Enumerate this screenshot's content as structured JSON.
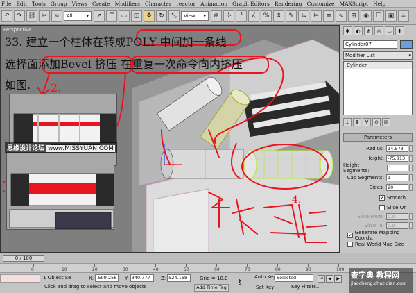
{
  "menu": [
    "File",
    "Edit",
    "Tools",
    "Group",
    "Views",
    "Create",
    "Modifiers",
    "Character",
    "reactor",
    "Animation",
    "Graph Editors",
    "Rendering",
    "Customize",
    "MAXScript",
    "Help"
  ],
  "toolbar": {
    "selection_filter": "All",
    "ref_coord": "View"
  },
  "viewport": {
    "label": "Perspective",
    "tutorial_line1": "33. 建立一个柱体在转成POLY 中间加一条线",
    "tutorial_line2": "选择面添加Bevel 挤压 在重复一次命令向内挤压",
    "tutorial_line3": "如图.",
    "watermark_text": "思缘设计论坛",
    "watermark_url": "www.MISSYUAN.COM",
    "annot_2": "2.",
    "annot_3": "3.",
    "annot_4": "4.",
    "annot_handwriting": "放柱这里"
  },
  "command_panel": {
    "object_name": "Cylinder07",
    "modifier_list": "Modifier List",
    "stack_item": "Cylinder",
    "rollout": "Parameters",
    "params": {
      "radius_label": "Radius:",
      "radius": "14.573",
      "height_label": "Height:",
      "height": "-75.813",
      "height_segments_label": "Height Segments:",
      "height_segments": "1",
      "cap_segments_label": "Cap Segments:",
      "cap_segments": "1",
      "sides_label": "Sides:",
      "sides": "20",
      "smooth_label": "Smooth",
      "slice_on_label": "Slice On",
      "slice_from_label": "Slice From:",
      "slice_from": "0.0",
      "slice_to_label": "Slice To:",
      "slice_to": "0.0",
      "gen_mapping_label": "Generate Mapping Coords.",
      "realworld_label": "Real-World Map Size"
    },
    "smooth_checked": true,
    "slice_on_checked": false,
    "gen_mapping_checked": true,
    "realworld_checked": false
  },
  "timeline": {
    "slider": "0 / 100",
    "ticks": [
      "0",
      "10",
      "20",
      "30",
      "40",
      "50",
      "60",
      "70",
      "80",
      "90",
      "100"
    ]
  },
  "status": {
    "selection": "1 Object Se",
    "x_label": "X:",
    "x": "-599.256",
    "y_label": "Y:",
    "y": "340.777",
    "z_label": "Z:",
    "z": "524.168",
    "grid": "Grid = 10.0",
    "prompt": "Click and drag to select and move objects",
    "add_time_tag": "Add Time Tag",
    "auto_key": "Auto Key",
    "set_key": "Set Key",
    "selected": "Selected",
    "key_filters": "Key Filters..."
  },
  "site_watermark": {
    "name": "查字典 教程网",
    "url": "jiaocheng.chazidian.com"
  },
  "colors": {
    "annotation_red": "#e8141e",
    "selection_green": "#b6e83a",
    "object_color": "#6aa0e0"
  }
}
